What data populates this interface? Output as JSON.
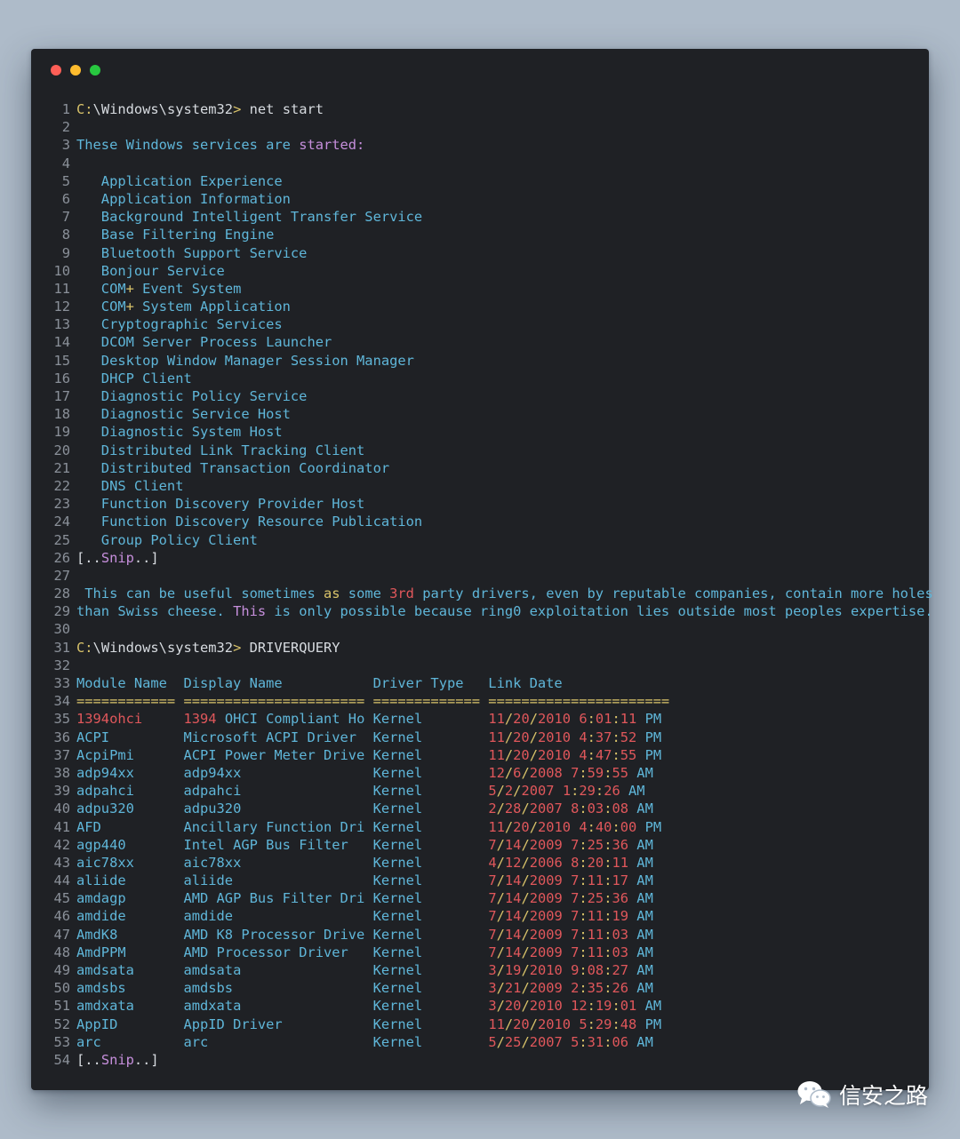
{
  "theme": {
    "background": "#aebbc9",
    "window": "#1f2125",
    "line_number": "#8a9099",
    "default": "#d7dbe0",
    "cyan": "#5fb6d9",
    "yellow": "#d9c36a",
    "purple": "#c68fdc",
    "red": "#e0575b",
    "green": "#9bd08a",
    "dot_close": "#fe5f57",
    "dot_minimize": "#febc2e",
    "dot_maximize": "#28c840"
  },
  "window": {
    "buttons": [
      "close",
      "minimize",
      "maximize"
    ]
  },
  "lines": [
    "C:\\Windows\\system32> net start",
    "",
    "These Windows services are started:",
    "",
    "   Application Experience",
    "   Application Information",
    "   Background Intelligent Transfer Service",
    "   Base Filtering Engine",
    "   Bluetooth Support Service",
    "   Bonjour Service",
    "   COM+ Event System",
    "   COM+ System Application",
    "   Cryptographic Services",
    "   DCOM Server Process Launcher",
    "   Desktop Window Manager Session Manager",
    "   DHCP Client",
    "   Diagnostic Policy Service",
    "   Diagnostic Service Host",
    "   Diagnostic System Host",
    "   Distributed Link Tracking Client",
    "   Distributed Transaction Coordinator",
    "   DNS Client",
    "   Function Discovery Provider Host",
    "   Function Discovery Resource Publication",
    "   Group Policy Client",
    "[..Snip..]",
    "",
    " This can be useful sometimes as some 3rd party drivers, even by reputable companies, contain more holes",
    "than Swiss cheese. This is only possible because ring0 exploitation lies outside most peoples expertise.",
    "",
    "C:\\Windows\\system32> DRIVERQUERY",
    "",
    "Module Name  Display Name           Driver Type   Link Date",
    "============ ====================== ============= ======================",
    "1394ohci     1394 OHCI Compliant Ho Kernel        11/20/2010 6:01:11 PM",
    "ACPI         Microsoft ACPI Driver  Kernel        11/20/2010 4:37:52 PM",
    "AcpiPmi      ACPI Power Meter Drive Kernel        11/20/2010 4:47:55 PM",
    "adp94xx      adp94xx                Kernel        12/6/2008 7:59:55 AM",
    "adpahci      adpahci                Kernel        5/2/2007 1:29:26 AM",
    "adpu320      adpu320                Kernel        2/28/2007 8:03:08 AM",
    "AFD          Ancillary Function Dri Kernel        11/20/2010 4:40:00 PM",
    "agp440       Intel AGP Bus Filter   Kernel        7/14/2009 7:25:36 AM",
    "aic78xx      aic78xx                Kernel        4/12/2006 8:20:11 AM",
    "aliide       aliide                 Kernel        7/14/2009 7:11:17 AM",
    "amdagp       AMD AGP Bus Filter Dri Kernel        7/14/2009 7:25:36 AM",
    "amdide       amdide                 Kernel        7/14/2009 7:11:19 AM",
    "AmdK8        AMD K8 Processor Drive Kernel        7/14/2009 7:11:03 AM",
    "AmdPPM       AMD Processor Driver   Kernel        7/14/2009 7:11:03 AM",
    "amdsata      amdsata                Kernel        3/19/2010 9:08:27 AM",
    "amdsbs       amdsbs                 Kernel        3/21/2009 2:35:26 AM",
    "amdxata      amdxata                Kernel        3/20/2010 12:19:01 AM",
    "AppID        AppID Driver           Kernel        11/20/2010 5:29:48 PM",
    "arc          arc                    Kernel        5/25/2007 5:31:06 AM",
    "[..Snip..]"
  ],
  "watermark": {
    "icon": "wechat-icon",
    "text": "信安之路"
  }
}
